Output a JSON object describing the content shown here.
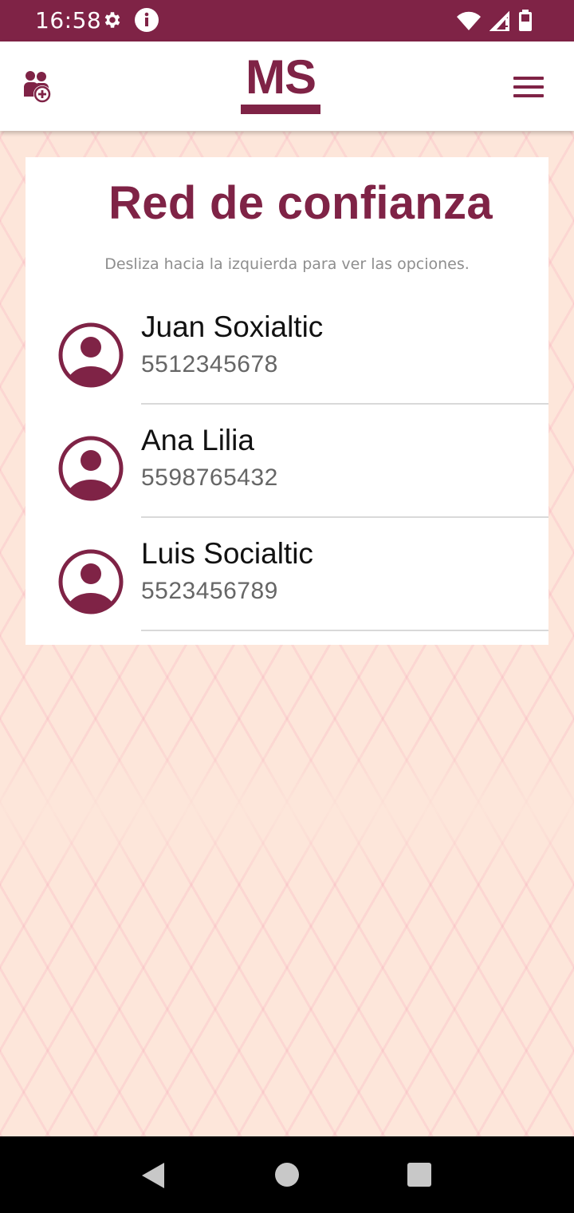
{
  "status_bar": {
    "time": "16:58",
    "icons": [
      "gear-icon",
      "info-icon",
      "wifi-icon",
      "signal-icon",
      "battery-icon"
    ]
  },
  "app_bar": {
    "logo_text": "MS",
    "left_icon": "add-contact-icon",
    "right_icon": "hamburger-menu-icon"
  },
  "main": {
    "title": "Red de confianza",
    "hint": "Desliza hacia la izquierda para ver las opciones.",
    "contacts": [
      {
        "name": "Juan Soxialtic",
        "phone": "5512345678",
        "icon": "user-avatar-icon"
      },
      {
        "name": "Ana Lilia",
        "phone": "5598765432",
        "icon": "user-avatar-icon"
      },
      {
        "name": "Luis Socialtic",
        "phone": "5523456789",
        "icon": "user-avatar-icon"
      }
    ]
  },
  "nav_bar": {
    "buttons": [
      "back-icon",
      "home-icon",
      "recents-icon"
    ]
  },
  "colors": {
    "brand": "#7f2346",
    "background": "#fde6da",
    "pattern": "#f6a0b4",
    "card": "#ffffff",
    "name_text": "#111111",
    "phone_text": "#666666",
    "hint_text": "#8e8e8e"
  }
}
